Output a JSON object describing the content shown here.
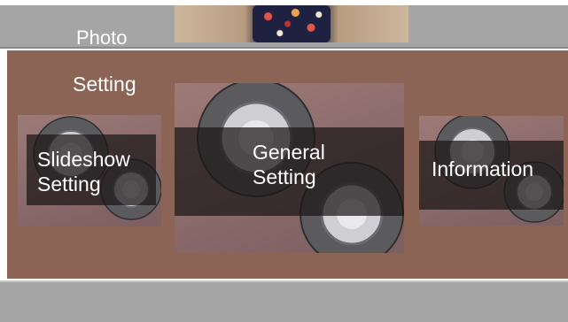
{
  "header": {
    "photo_label": "Photo"
  },
  "section": {
    "heading": "Setting"
  },
  "tiles": [
    {
      "line1": "Slideshow",
      "line2": "Setting",
      "icon": "gear-icon"
    },
    {
      "line1": "General",
      "line2": "Setting",
      "icon": "gear-icon"
    },
    {
      "line1": "Information",
      "line2": "",
      "icon": "gear-icon"
    }
  ],
  "colors": {
    "panel": "#8b6455",
    "band": "#a5a5a5",
    "label_overlay": "rgba(28,22,24,0.72)",
    "text": "#ffffff"
  }
}
